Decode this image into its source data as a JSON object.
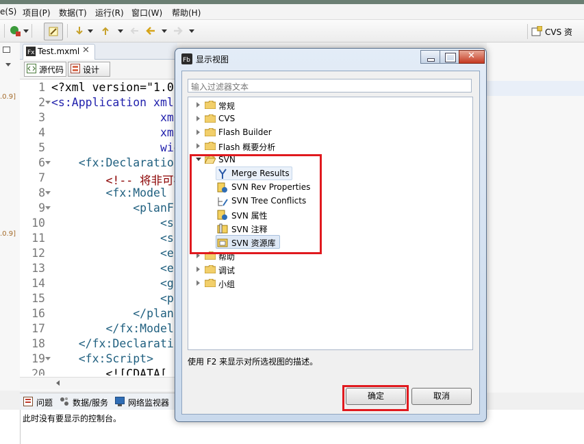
{
  "menubar": {
    "items": [
      "e(S)",
      "项目(P)",
      "数据(T)",
      "运行(R)",
      "窗口(W)",
      "帮助(H)"
    ]
  },
  "toolbar": {
    "perspective_label": "CVS 资"
  },
  "editor": {
    "tab_label": "Test.mxml",
    "source_tab": "源代码",
    "design_tab": "设计",
    "lines": [
      {
        "n": "1",
        "fold": false,
        "text": "<?xml version=\"1.0",
        "color": "#000000"
      },
      {
        "n": "2",
        "fold": true,
        "text": "<s:Application xml",
        "color": "#2222ad"
      },
      {
        "n": "3",
        "fold": false,
        "text": "                xml",
        "color": "#2222ad"
      },
      {
        "n": "4",
        "fold": false,
        "text": "                xml",
        "color": "#2222ad"
      },
      {
        "n": "5",
        "fold": false,
        "text": "                wid",
        "color": "#2222ad"
      },
      {
        "n": "6",
        "fold": true,
        "text": "    <fx:Declaratio",
        "color": "#1f5f7f"
      },
      {
        "n": "7",
        "fold": false,
        "text": "        <!-- 将非可视",
        "color": "#8b0000"
      },
      {
        "n": "8",
        "fold": true,
        "text": "        <fx:Model ",
        "color": "#1f5f7f"
      },
      {
        "n": "9",
        "fold": true,
        "text": "            <planF",
        "color": "#1f5f7f"
      },
      {
        "n": "10",
        "fold": false,
        "text": "                <s",
        "color": "#1f5f7f"
      },
      {
        "n": "11",
        "fold": false,
        "text": "                <s",
        "color": "#1f5f7f"
      },
      {
        "n": "12",
        "fold": false,
        "text": "                <e",
        "color": "#1f5f7f"
      },
      {
        "n": "13",
        "fold": false,
        "text": "                <e",
        "color": "#1f5f7f"
      },
      {
        "n": "14",
        "fold": false,
        "text": "                <g",
        "color": "#1f5f7f"
      },
      {
        "n": "15",
        "fold": false,
        "text": "                <p",
        "color": "#1f5f7f"
      },
      {
        "n": "16",
        "fold": false,
        "text": "            </plan",
        "color": "#1f5f7f"
      },
      {
        "n": "17",
        "fold": false,
        "text": "        </fx:Model",
        "color": "#1f5f7f"
      },
      {
        "n": "18",
        "fold": false,
        "text": "    </fx:Declarati",
        "color": "#1f5f7f"
      },
      {
        "n": "19",
        "fold": true,
        "text": "    <fx:Script>",
        "color": "#1f5f7f"
      },
      {
        "n": "20",
        "fold": false,
        "text": "        <![CDATA[",
        "color": "#000000"
      }
    ]
  },
  "left_strip": {
    "marks": [
      ".0.9]",
      ".0.9]"
    ]
  },
  "bottom": {
    "tabs": [
      "问题",
      "数据/服务",
      "网络监视器"
    ],
    "console_message": "此时没有要显示的控制台。"
  },
  "dialog": {
    "title": "显示视图",
    "filter_placeholder": "输入过滤器文本",
    "tree": {
      "groups": [
        "常规",
        "CVS",
        "Flash Builder",
        "Flash 概要分析"
      ],
      "svn_label": "SVN",
      "svn_children": [
        "Merge Results",
        "SVN Rev Properties",
        "SVN Tree Conflicts",
        "SVN 属性",
        "SVN 注释",
        "SVN 资源库"
      ],
      "after_groups": [
        "帮助",
        "调试",
        "小组"
      ]
    },
    "description": "使用 F2 来显示对所选视图的描述。",
    "ok_label": "确定",
    "cancel_label": "取消"
  },
  "colors": {
    "highlight_red": "#e0191e",
    "dialog_frame": "#c9d9ec"
  }
}
